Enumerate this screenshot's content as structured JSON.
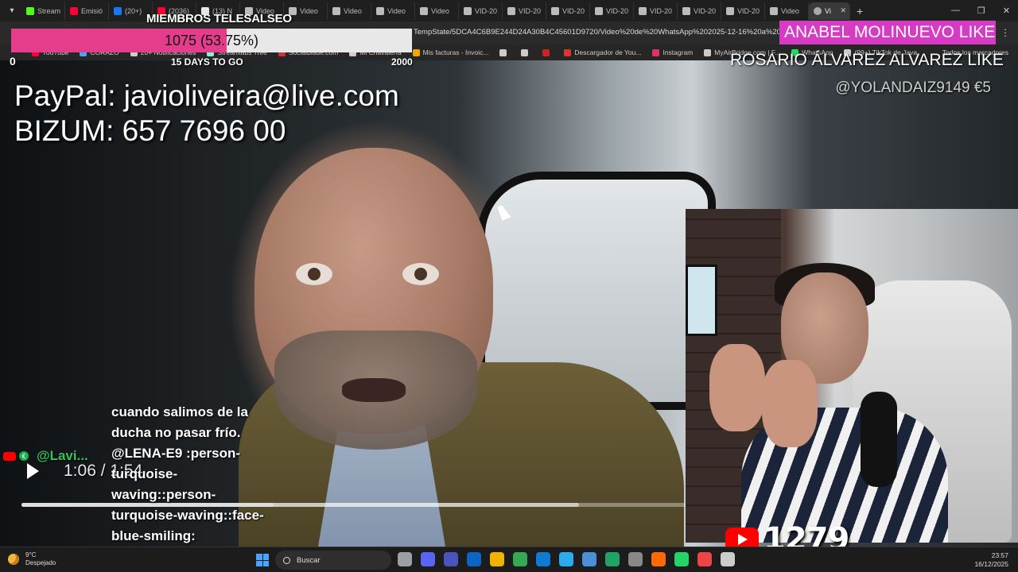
{
  "browser": {
    "tabs": [
      {
        "label": "Stream",
        "color": "#53fc18"
      },
      {
        "label": "Emisió",
        "color": "#ff0033"
      },
      {
        "label": "(20+) ",
        "color": "#1877f2"
      },
      {
        "label": "(2036)",
        "color": "#ff0033"
      },
      {
        "label": "(13) N",
        "color": "#e6e6e6"
      },
      {
        "label": "Video",
        "color": "#bbbbbb"
      },
      {
        "label": "Video",
        "color": "#bbbbbb"
      },
      {
        "label": "Video",
        "color": "#bbbbbb"
      },
      {
        "label": "Video",
        "color": "#bbbbbb"
      },
      {
        "label": "Video",
        "color": "#bbbbbb"
      },
      {
        "label": "VID-20",
        "color": "#bbbbbb"
      },
      {
        "label": "VID-20",
        "color": "#bbbbbb"
      },
      {
        "label": "VID-20",
        "color": "#bbbbbb"
      },
      {
        "label": "VID-20",
        "color": "#bbbbbb"
      },
      {
        "label": "VID-20",
        "color": "#bbbbbb"
      },
      {
        "label": "VID-20",
        "color": "#bbbbbb"
      },
      {
        "label": "VID-20",
        "color": "#bbbbbb"
      },
      {
        "label": "Video",
        "color": "#bbbbbb"
      }
    ],
    "active_tab": "Vi",
    "url": "TempState/5DCA4C6B9E244D24A30B4C45601D9720/Video%20de%20WhatsApp%202025-12-16%20a%20las%",
    "bookmarks": [
      {
        "label": "YouTube",
        "color": "#ff0033"
      },
      {
        "label": "CORAZO",
        "color": "#4aa3ff"
      },
      {
        "label": "20+ Notificaciones",
        "color": "#cccccc"
      },
      {
        "label": "Streamlabs Tree",
        "color": "#80f5d2"
      },
      {
        "label": "Socialblade.com",
        "color": "#cc3333"
      },
      {
        "label": "Mi Chavalería",
        "color": "#cccccc"
      },
      {
        "label": "Mis facturas - Invoic...",
        "color": "#f0a500"
      },
      {
        "label": "",
        "color": "#cccccc"
      },
      {
        "label": "",
        "color": "#cccccc"
      },
      {
        "label": "",
        "color": "#cc2222"
      },
      {
        "label": "Descargador de You...",
        "color": "#dd3333"
      },
      {
        "label": "Instagram",
        "color": "#e1306c"
      },
      {
        "label": "MyAirBridge.com | F...",
        "color": "#cccccc"
      },
      {
        "label": "WhatsApp",
        "color": "#25d366"
      },
      {
        "label": "(99+) TikTok de Java",
        "color": "#cccccc"
      }
    ],
    "all_bookmarks": "Todos los marcadores"
  },
  "goal": {
    "title": "MIEMBROS TELESALSEO",
    "text": "1075 (53.75%)",
    "fraction": 0.5375,
    "min": "0",
    "max": "2000",
    "days": "15 DAYS TO GO",
    "fill_color": "#e63c8c"
  },
  "donations": {
    "paypal": "PayPal: javioliveira@live.com",
    "bizum": "BIZUM: 657 7696 00"
  },
  "alerts": {
    "pink": "ANABEL MOLINUEVO  LIKE",
    "second": "ROSARIO ÁLVAREZ ALVAREZ  LIKE",
    "user": "@YOLANDAIZ9149  €5"
  },
  "player": {
    "time": "1:06 / 1:54",
    "played_fraction": 0.38,
    "buffered_fraction": 0.84
  },
  "chat": {
    "user": "@Lavi...",
    "message": "cuando salimos de la ducha no pasar frío. @LENA-E9 :person-turquoise-waving::person-turquoise-waving::face-blue-smiling:"
  },
  "webcam": {
    "youtube_count": "1279"
  },
  "taskbar": {
    "temp": "9°C",
    "weather": "Despejado",
    "search": "Buscar",
    "time": "23:57",
    "date": "16/12/2025",
    "apps": [
      "#9aa0a6",
      "#5865f2",
      "#4b53bc",
      "#0a66c2",
      "#f0b400",
      "#34a853",
      "#0c7bd1",
      "#2aabee",
      "#4a8fd8",
      "#21a366",
      "#888888",
      "#ff6a00",
      "#25d366",
      "#e44",
      "#cccccc"
    ]
  }
}
